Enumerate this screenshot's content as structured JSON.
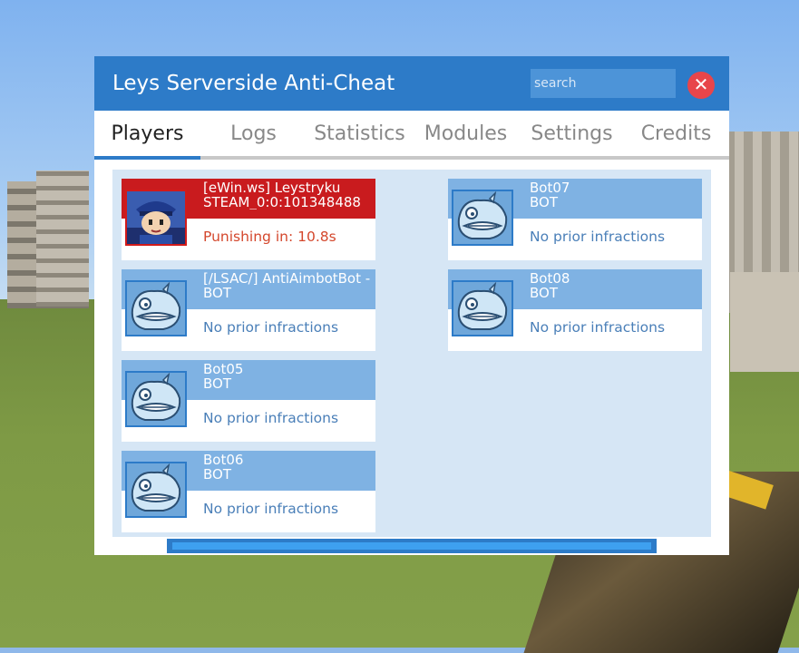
{
  "window": {
    "title": "Leys Serverside Anti-Cheat"
  },
  "search": {
    "placeholder": "search",
    "value": ""
  },
  "tabs": [
    {
      "label": "Players",
      "active": true
    },
    {
      "label": "Logs"
    },
    {
      "label": "Statistics"
    },
    {
      "label": "Modules"
    },
    {
      "label": "Settings"
    },
    {
      "label": "Credits"
    }
  ],
  "players": [
    {
      "name": "[eWin.ws] Leystryku",
      "steamid": "STEAM_0:0:101348488",
      "status": "Punishing in: 10.8s",
      "flagged": true,
      "avatar_icon": "player-avatar-icon"
    },
    {
      "name": "[/LSAC/] AntiAimbotBot - by Leystryku",
      "steamid": "BOT",
      "status": "No prior infractions",
      "flagged": false,
      "avatar_icon": "bot-avatar-icon"
    },
    {
      "name": "Bot05",
      "steamid": "BOT",
      "status": "No prior infractions",
      "flagged": false,
      "avatar_icon": "bot-avatar-icon"
    },
    {
      "name": "Bot06",
      "steamid": "BOT",
      "status": "No prior infractions",
      "flagged": false,
      "avatar_icon": "bot-avatar-icon"
    },
    {
      "name": "Bot07",
      "steamid": "BOT",
      "status": "No prior infractions",
      "flagged": false,
      "avatar_icon": "bot-avatar-icon"
    },
    {
      "name": "Bot08",
      "steamid": "BOT",
      "status": "No prior infractions",
      "flagged": false,
      "avatar_icon": "bot-avatar-icon"
    }
  ],
  "colors": {
    "accent": "#2d7bc8",
    "flagged": "#c91b1e",
    "card_header": "#7fb2e3",
    "close": "#e8454a"
  }
}
